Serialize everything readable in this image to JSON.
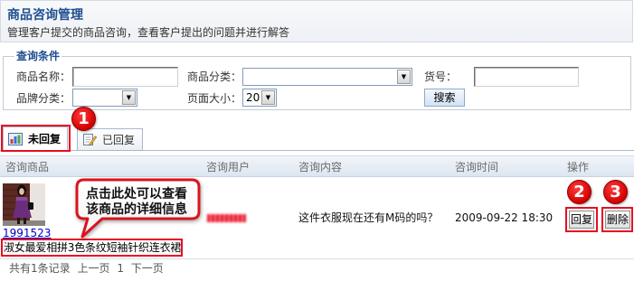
{
  "header": {
    "title": "商品咨询管理",
    "subtitle": "管理客户提交的商品咨询，查看客户提出的问题并进行解答"
  },
  "search": {
    "legend": "查询条件",
    "product_name": {
      "label": "商品名称：",
      "value": ""
    },
    "category": {
      "label": "商品分类：",
      "value": ""
    },
    "sku": {
      "label": "货号：",
      "value": ""
    },
    "brand": {
      "label": "品牌分类：",
      "value": ""
    },
    "page_size": {
      "label": "页面大小：",
      "value": "20"
    },
    "submit_label": "搜索"
  },
  "tabs": [
    {
      "label": "未回复",
      "icon": "chart-icon",
      "active": true
    },
    {
      "label": "已回复",
      "icon": "edit-note-icon",
      "active": false
    }
  ],
  "table": {
    "columns": [
      "咨询商品",
      "咨询用户",
      "咨询内容",
      "咨询时间",
      "操作"
    ],
    "rows": [
      {
        "product_id": "1991523",
        "product_name": "淑女最爱相拼3色条纹短袖针织连衣裙",
        "content": "这件衣服现在还有M码的吗？",
        "time": "2009-09-22 18:30",
        "reply_label": "回复",
        "delete_label": "删除"
      }
    ]
  },
  "footer": {
    "total": "共有1条记录",
    "prev": "上一页",
    "page": "1",
    "next": "下一页"
  },
  "annotations": {
    "badges": [
      "1",
      "2",
      "3"
    ],
    "callout": {
      "line1": "点击此处可以查看",
      "line2": "该商品的详细信息"
    }
  },
  "colors": {
    "title_blue": "#1f4e91",
    "annotation_red": "#e60f23",
    "link_blue": "#0000cc",
    "table_header_bg": "#dde6f0"
  }
}
